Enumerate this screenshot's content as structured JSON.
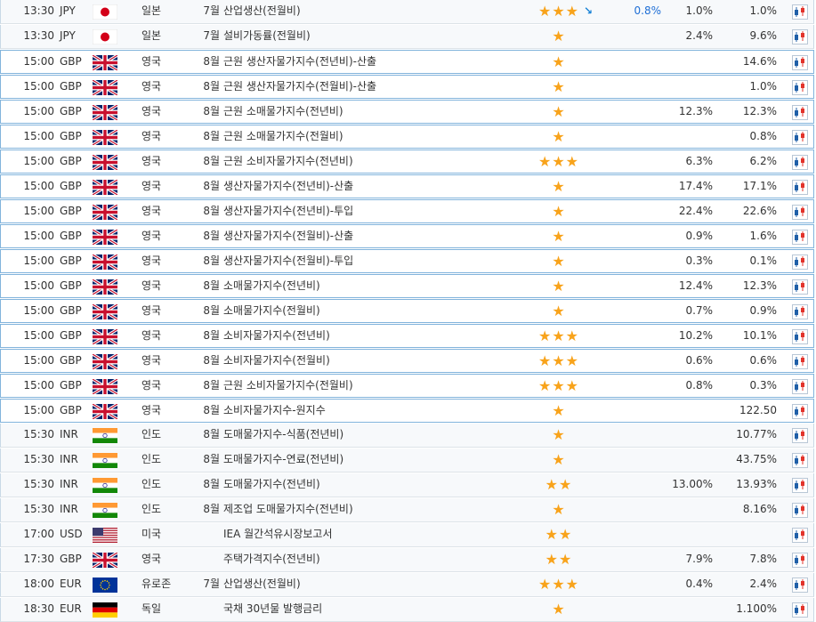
{
  "rows": [
    {
      "time": "13:30",
      "currency": "JPY",
      "flag": "jp",
      "country": "일본",
      "period": "7월",
      "event": "산업생산(전월비)",
      "stars": "★★★",
      "arrow": "↘",
      "actual": "0.8%",
      "forecast": "1.0%",
      "previous": "1.0%",
      "style": "alt"
    },
    {
      "time": "13:30",
      "currency": "JPY",
      "flag": "jp",
      "country": "일본",
      "period": "7월",
      "event": "설비가동률(전월비)",
      "stars": "★",
      "arrow": "",
      "actual": "",
      "forecast": "2.4%",
      "previous": "9.6%",
      "style": "alt"
    },
    {
      "time": "15:00",
      "currency": "GBP",
      "flag": "gb",
      "country": "영국",
      "period": "8월",
      "event": "근원 생산자물가지수(전년비)-산출",
      "stars": "★",
      "arrow": "",
      "actual": "",
      "forecast": "",
      "previous": "14.6%",
      "style": "blue"
    },
    {
      "time": "15:00",
      "currency": "GBP",
      "flag": "gb",
      "country": "영국",
      "period": "8월",
      "event": "근원 생산자물가지수(전월비)-산출",
      "stars": "★",
      "arrow": "",
      "actual": "",
      "forecast": "",
      "previous": "1.0%",
      "style": "blue"
    },
    {
      "time": "15:00",
      "currency": "GBP",
      "flag": "gb",
      "country": "영국",
      "period": "8월",
      "event": "근원 소매물가지수(전년비)",
      "stars": "★",
      "arrow": "",
      "actual": "",
      "forecast": "12.3%",
      "previous": "12.3%",
      "style": "blue"
    },
    {
      "time": "15:00",
      "currency": "GBP",
      "flag": "gb",
      "country": "영국",
      "period": "8월",
      "event": "근원 소매물가지수(전월비)",
      "stars": "★",
      "arrow": "",
      "actual": "",
      "forecast": "",
      "previous": "0.8%",
      "style": "blue"
    },
    {
      "time": "15:00",
      "currency": "GBP",
      "flag": "gb",
      "country": "영국",
      "period": "8월",
      "event": "근원 소비자물가지수(전년비)",
      "stars": "★★★",
      "arrow": "",
      "actual": "",
      "forecast": "6.3%",
      "previous": "6.2%",
      "style": "blue"
    },
    {
      "time": "15:00",
      "currency": "GBP",
      "flag": "gb",
      "country": "영국",
      "period": "8월",
      "event": "생산자물가지수(전년비)-산출",
      "stars": "★",
      "arrow": "",
      "actual": "",
      "forecast": "17.4%",
      "previous": "17.1%",
      "style": "blue"
    },
    {
      "time": "15:00",
      "currency": "GBP",
      "flag": "gb",
      "country": "영국",
      "period": "8월",
      "event": "생산자물가지수(전년비)-투입",
      "stars": "★",
      "arrow": "",
      "actual": "",
      "forecast": "22.4%",
      "previous": "22.6%",
      "style": "blue"
    },
    {
      "time": "15:00",
      "currency": "GBP",
      "flag": "gb",
      "country": "영국",
      "period": "8월",
      "event": "생산자물가지수(전월비)-산출",
      "stars": "★",
      "arrow": "",
      "actual": "",
      "forecast": "0.9%",
      "previous": "1.6%",
      "style": "blue"
    },
    {
      "time": "15:00",
      "currency": "GBP",
      "flag": "gb",
      "country": "영국",
      "period": "8월",
      "event": "생산자물가지수(전월비)-투입",
      "stars": "★",
      "arrow": "",
      "actual": "",
      "forecast": "0.3%",
      "previous": "0.1%",
      "style": "blue"
    },
    {
      "time": "15:00",
      "currency": "GBP",
      "flag": "gb",
      "country": "영국",
      "period": "8월",
      "event": "소매물가지수(전년비)",
      "stars": "★",
      "arrow": "",
      "actual": "",
      "forecast": "12.4%",
      "previous": "12.3%",
      "style": "blue"
    },
    {
      "time": "15:00",
      "currency": "GBP",
      "flag": "gb",
      "country": "영국",
      "period": "8월",
      "event": "소매물가지수(전월비)",
      "stars": "★",
      "arrow": "",
      "actual": "",
      "forecast": "0.7%",
      "previous": "0.9%",
      "style": "blue"
    },
    {
      "time": "15:00",
      "currency": "GBP",
      "flag": "gb",
      "country": "영국",
      "period": "8월",
      "event": "소비자물가지수(전년비)",
      "stars": "★★★",
      "arrow": "",
      "actual": "",
      "forecast": "10.2%",
      "previous": "10.1%",
      "style": "blue"
    },
    {
      "time": "15:00",
      "currency": "GBP",
      "flag": "gb",
      "country": "영국",
      "period": "8월",
      "event": "소비자물가지수(전월비)",
      "stars": "★★★",
      "arrow": "",
      "actual": "",
      "forecast": "0.6%",
      "previous": "0.6%",
      "style": "blue"
    },
    {
      "time": "15:00",
      "currency": "GBP",
      "flag": "gb",
      "country": "영국",
      "period": "8월",
      "event": "근원 소비자물가지수(전월비)",
      "stars": "★★★",
      "arrow": "",
      "actual": "",
      "forecast": "0.8%",
      "previous": "0.3%",
      "style": "blue"
    },
    {
      "time": "15:00",
      "currency": "GBP",
      "flag": "gb",
      "country": "영국",
      "period": "8월",
      "event": "소비자물가지수-원지수",
      "stars": "★",
      "arrow": "",
      "actual": "",
      "forecast": "",
      "previous": "122.50",
      "style": "blue"
    },
    {
      "time": "15:30",
      "currency": "INR",
      "flag": "in",
      "country": "인도",
      "period": "8월",
      "event": "도매물가지수-식품(전년비)",
      "stars": "★",
      "arrow": "",
      "actual": "",
      "forecast": "",
      "previous": "10.77%",
      "style": "alt"
    },
    {
      "time": "15:30",
      "currency": "INR",
      "flag": "in",
      "country": "인도",
      "period": "8월",
      "event": "도매물가지수-연료(전년비)",
      "stars": "★",
      "arrow": "",
      "actual": "",
      "forecast": "",
      "previous": "43.75%",
      "style": "alt"
    },
    {
      "time": "15:30",
      "currency": "INR",
      "flag": "in",
      "country": "인도",
      "period": "8월",
      "event": "도매물가지수(전년비)",
      "stars": "★★",
      "arrow": "",
      "actual": "",
      "forecast": "13.00%",
      "previous": "13.93%",
      "style": "alt"
    },
    {
      "time": "15:30",
      "currency": "INR",
      "flag": "in",
      "country": "인도",
      "period": "8월",
      "event": "제조업 도매물가지수(전년비)",
      "stars": "★",
      "arrow": "",
      "actual": "",
      "forecast": "",
      "previous": "8.16%",
      "style": "alt"
    },
    {
      "time": "17:00",
      "currency": "USD",
      "flag": "us",
      "country": "미국",
      "period": "",
      "event": "IEA 월간석유시장보고서",
      "stars": "★★",
      "arrow": "",
      "actual": "",
      "forecast": "",
      "previous": "",
      "style": "alt"
    },
    {
      "time": "17:30",
      "currency": "GBP",
      "flag": "gb",
      "country": "영국",
      "period": "",
      "event": "주택가격지수(전년비)",
      "stars": "★★",
      "arrow": "",
      "actual": "",
      "forecast": "7.9%",
      "previous": "7.8%",
      "style": "alt"
    },
    {
      "time": "18:00",
      "currency": "EUR",
      "flag": "eu",
      "country": "유로존",
      "period": "7월",
      "event": "산업생산(전월비)",
      "stars": "★★★",
      "arrow": "",
      "actual": "",
      "forecast": "0.4%",
      "previous": "2.4%",
      "style": "alt"
    },
    {
      "time": "18:30",
      "currency": "EUR",
      "flag": "de",
      "country": "독일",
      "period": "",
      "event": "국채 30년물 발행금리",
      "stars": "★",
      "arrow": "",
      "actual": "",
      "forecast": "",
      "previous": "1.100%",
      "style": "alt"
    }
  ],
  "colors": {
    "star": "#f8a31b",
    "actual": "#1f6fd6",
    "blue_border": "#82b4dc"
  }
}
